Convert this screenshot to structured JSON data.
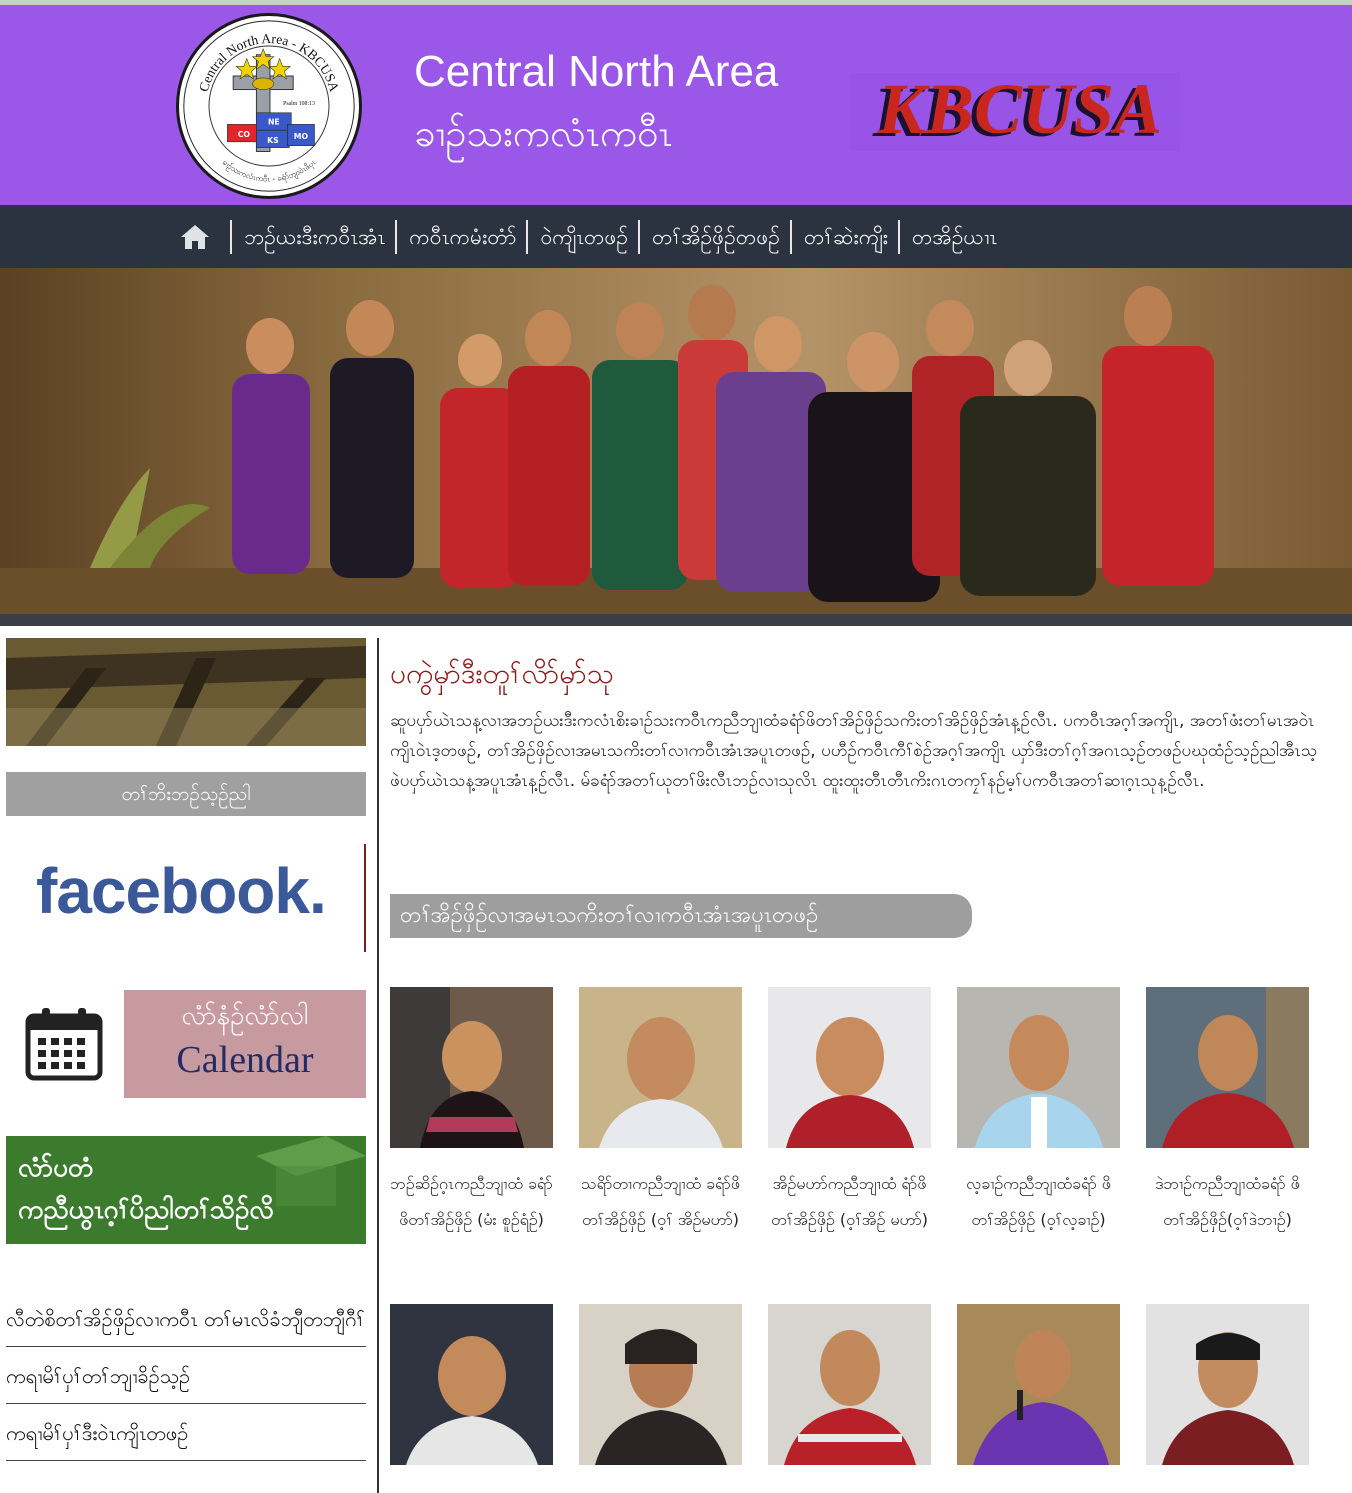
{
  "header": {
    "seal_text": "Central North Area - KBCUSA",
    "seal_bottom_text": "ခၢဉ်သးကလံၤကဝီၤ - ခရံာ်ဘျာဝဲၤဖိပှၤ",
    "seal_psalm": "Psalm 108:13",
    "seal_states": [
      "CO",
      "NE",
      "KS",
      "MO"
    ],
    "title": "Central North Area",
    "subtitle": "ခၢဉ်သးကလံၤကဝီၤ",
    "logo_text": "KBCUSA"
  },
  "nav": {
    "home_icon": "home-icon",
    "items": [
      "ဘဉ်ယးဒီးကဝီၤအံၤ",
      "ကဝီၤကမံးတံာ်",
      "ဝဲကျိၤတဖဉ်",
      "တၢ်အိဉ်ဖှိဉ်တဖဉ်",
      "တၢ်ဆဲးကျိး",
      "တအိဉ်ယၢၤ"
    ]
  },
  "sidebar": {
    "grey_bar": "တၢ်ဘိးဘဉ်သ့ဉ်ညါ",
    "facebook": "facebook.",
    "calendar_my": "လံာ်နံဉ်လံာ်လါ",
    "calendar_en": "Calendar",
    "grad_line1": "လံာ်ပတံ",
    "grad_line2": "ကညီယွၤဂ့ၢ်ပိညါတၢ်သိဉ်လိ",
    "links": [
      "လီတဲစိတၢ်အိဉ်ဖှိဉ်လၢကဝီၤ တၢ်မၤလိခံဘျီတဘျီဂီၢ်",
      "ကရၢမိၢ်ပှၢ်တၢ်ဘျၢခိဉ်သ့ဉ်",
      "ကရၢမိၢ်ပှၢ်ဒီးဝဲၤကျိၤတဖဉ်"
    ]
  },
  "main": {
    "title": "ပကွဲမှာ်ဒီးတူၢ်လိာ်မှာ်သု",
    "paragraph": "ဆူပပှာ်ယဲၤသန့လၢအဘဉ်ယးဒီးကလံၤစိးခၢဉ်သးကဝီၤကညီဘျၢထံခရံာ်ဖိတၢ်အိဉ်ဖှိဉ်သကိးတၢ်အိဉ်ဖှိဉ်အံၤန့ဉ်လီၤ. ပကဝီၤအဂ့ၢ်အကျိၤ, အတၢ်ဖံးတၢ်မၤအဝဲၤကျိၤဝဲၤဒ့တဖဉ်, တၢ်အိဉ်ဖှိဉ်လၢအမၤသကိးတၢ်လၢကဝီၤအံၤအပူၤတဖဉ်, ပဟီဉ်ကဝီၤကီၢ်စဲဉ်အဂ့ၢ်အကျိၤ ယှာ်ဒီးတၢ်ဂ့ၢ်အဂၤသ့ဉ်တဖဉ်ပဃုထံဉ်သ့ဉ်ညါအီၤသ့ဖဲပပှာ်ယဲၤသန့အပူၤအံၤန့ဉ်လီၤ. မ်ခရံာ်အတၢ်ယုတၢ်ဖိးလီၤဘဉ်လၢသုလိၤ ထူးထူးတီၤတီၤကိးဂၤတကၠၢ်နဉ်မ့ၢ်ပကဝီၤအတၢ်ဆၢဂ့ၤသုန့ဉ်လီၤ.",
    "section_heading": "တၢ်အိဉ်ဖှိဉ်လၢအမၤသကိးတၢ်လၢကဝီၤအံၤအပူၤတဖဉ်",
    "cards": [
      {
        "caption": "ဘဉ်ဆိဉ်ဂ့ၤကညီဘျၢထံ ခရံာ်ဖိတၢ်အိဉ်ဖှိဉ် (မံး စူဉ်ရံဉ်)"
      },
      {
        "caption": "သရိာ်တၢကညီဘျၢထံ ခရံာ်ဖိတၢ်အိဉ်ဖှိဉ် (ဝ့ၢ် အိဉ်မဟာ်)"
      },
      {
        "caption": "အိဉ်မဟာ်ကညီဘျၢထံ ရံာ်ဖိတၢ်အိဉ်ဖှိဉ် (ဝ့ၢ်အိဉ် မဟာ်)"
      },
      {
        "caption": "လ့ခၢဉ်ကညီဘျၢထံခရံာ် ဖိတၢ်အိဉ်ဖှိဉ် (ဝ့ၢ်လ့ခၢဉ်)"
      },
      {
        "caption": "ဒဲဘၢဉ်ကညီဘျၢထံခရံာ် ဖိတၢ်အိဉ်ဖှိဉ်(ဝ့ၢ်ဒဲဘၢဉ်)"
      },
      {
        "caption": ""
      },
      {
        "caption": ""
      },
      {
        "caption": ""
      },
      {
        "caption": ""
      },
      {
        "caption": ""
      }
    ]
  },
  "colors": {
    "header_bg": "#9a57e8",
    "nav_bg": "#2b3340",
    "title_red": "#8b1a1a",
    "facebook_blue": "#3b5998"
  }
}
